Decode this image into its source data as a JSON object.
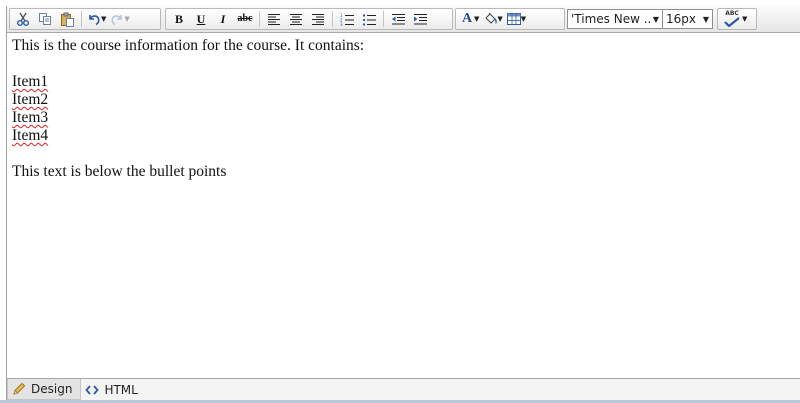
{
  "toolbar": {
    "font_name": "'Times New ...",
    "font_size": "16px",
    "bold_label": "B",
    "underline_label": "U",
    "italic_label": "I",
    "strike_label": "abc",
    "font_color_label": "A",
    "spellcheck_label": "ABC"
  },
  "content": {
    "intro": "This is the course information for the course. It contains:",
    "items": [
      "Item1",
      "Item2",
      "Item3",
      "Item4"
    ],
    "outro": "This text is below the bullet points"
  },
  "tabs": {
    "design": "Design",
    "html": "HTML"
  },
  "colors": {
    "accent_blue": "#2a5aa8",
    "spell_error": "#d22222"
  }
}
